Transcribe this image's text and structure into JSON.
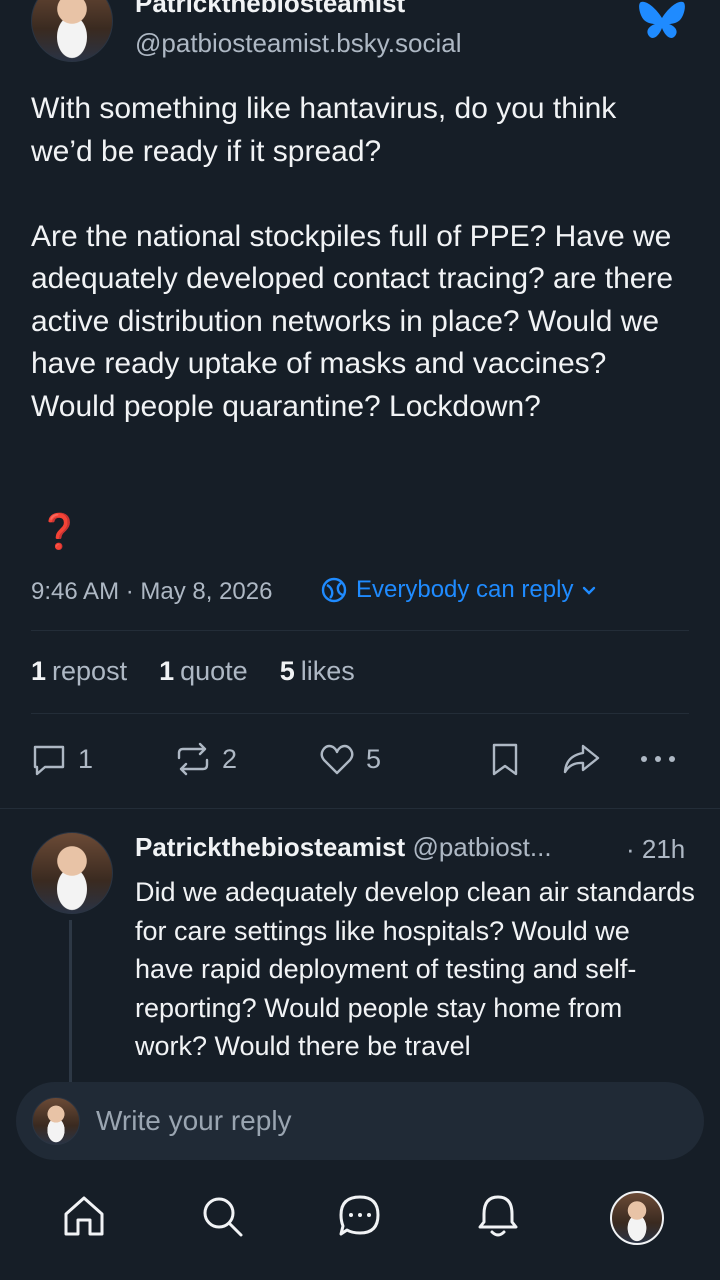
{
  "post": {
    "author_name": "Patrickthebiosteamist",
    "author_handle": "@patbiosteamist.bsky.social",
    "text": "With something like hantavirus, do you think we’d be ready if it spread?\n\nAre the national stockpiles full of PPE? Have we adequately developed contact tracing? are there active distribution networks in place? Would we have ready uptake of masks and vaccines? Would people quarantine? Lockdown?",
    "emoji": "❓",
    "timestamp": "9:46 AM · May 8, 2026",
    "reply_permission": "Everybody can reply",
    "stats": {
      "reposts_count": "1",
      "reposts_label": "repost",
      "quotes_count": "1",
      "quotes_label": "quote",
      "likes_count": "5",
      "likes_label": "likes"
    },
    "actions": {
      "reply_count": "1",
      "repost_count": "2",
      "like_count": "5"
    }
  },
  "reply": {
    "author_name": "Patrickthebiosteamist",
    "author_handle": "@patbiost...",
    "time": "· 21h",
    "text": "Did we adequately develop clean air standards for care settings like hospitals? Would we have rapid deployment of testing and self-reporting? Would people stay home from work? Would there be travel"
  },
  "composer": {
    "placeholder": "Write your reply"
  },
  "colors": {
    "background": "#161e27",
    "accent": "#1f8bff",
    "muted": "#aeb8c4",
    "alert": "#e0102a"
  },
  "icons": [
    "butterfly-logo-icon",
    "globe-icon",
    "chevron-down-icon",
    "reply-icon",
    "repost-icon",
    "like-icon",
    "bookmark-icon",
    "share-icon",
    "more-icon",
    "home-icon",
    "search-icon",
    "chat-icon",
    "bell-icon"
  ]
}
